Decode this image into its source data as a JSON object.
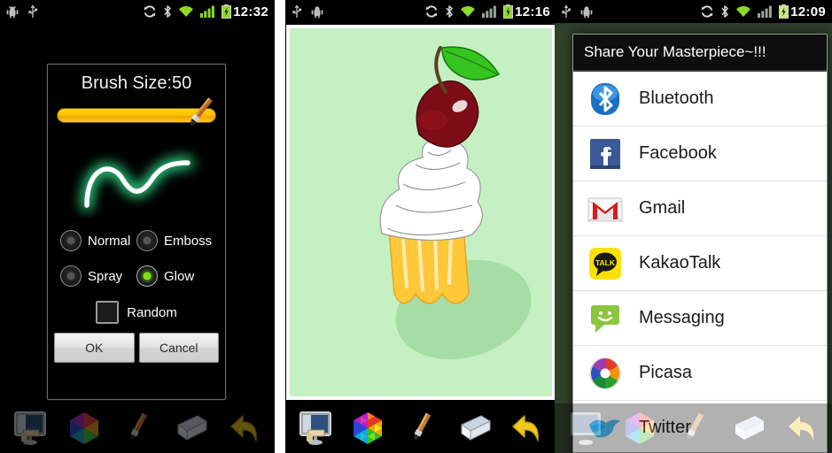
{
  "panels": [
    {
      "id": "brush-settings",
      "statusbar": {
        "time": "12:32",
        "left_icons": [
          "android-debug-icon",
          "usb-icon"
        ],
        "right_icons": [
          "sync-icon",
          "bluetooth-icon",
          "wifi-icon",
          "signal-icon",
          "battery-icon"
        ]
      },
      "dialog": {
        "title": "Brush Size:50",
        "brush_size": 50,
        "slider": {
          "value": 100,
          "min": 0,
          "max": 100,
          "thumb": "paintbrush-thumb-icon"
        },
        "preview": {
          "stroke_color": "#ffffff",
          "glow_color": "#2fe08a",
          "shape": "squiggle"
        },
        "modes": [
          {
            "label": "Normal",
            "selected": false
          },
          {
            "label": "Emboss",
            "selected": false
          },
          {
            "label": "Spray",
            "selected": false
          },
          {
            "label": "Glow",
            "selected": true
          }
        ],
        "checkbox": {
          "label": "Random",
          "checked": false
        },
        "buttons": {
          "ok": "OK",
          "cancel": "Cancel"
        }
      },
      "toolbar": [
        {
          "name": "new-canvas-icon"
        },
        {
          "name": "color-palette-icon"
        },
        {
          "name": "brush-icon"
        },
        {
          "name": "eraser-icon"
        },
        {
          "name": "undo-icon"
        }
      ]
    },
    {
      "id": "canvas",
      "statusbar": {
        "time": "12:16",
        "left_icons": [
          "usb-icon",
          "android-debug-icon"
        ],
        "right_icons": [
          "sync-icon",
          "bluetooth-icon",
          "wifi-icon",
          "signal-icon",
          "battery-icon"
        ]
      },
      "artwork": {
        "subject": "cupcake-with-cherry",
        "background_color": "#c4f0c4",
        "cherry_color": "#7c0d16",
        "leaf_color": "#35c420",
        "cream_color": "#ffffff",
        "cup_color": "#ffc838"
      },
      "toolbar": [
        {
          "name": "new-canvas-icon"
        },
        {
          "name": "color-palette-icon"
        },
        {
          "name": "brush-icon"
        },
        {
          "name": "eraser-icon"
        },
        {
          "name": "undo-icon"
        }
      ]
    },
    {
      "id": "share",
      "statusbar": {
        "time": "12:09",
        "left_icons": [
          "usb-icon",
          "android-debug-icon"
        ],
        "right_icons": [
          "sync-icon",
          "bluetooth-icon",
          "wifi-icon",
          "signal-icon",
          "battery-icon"
        ]
      },
      "dialog": {
        "title": "Share Your Masterpiece~!!!",
        "items": [
          {
            "label": "Bluetooth",
            "icon": "bluetooth-app-icon"
          },
          {
            "label": "Facebook",
            "icon": "facebook-app-icon"
          },
          {
            "label": "Gmail",
            "icon": "gmail-app-icon"
          },
          {
            "label": "KakaoTalk",
            "icon": "kakaotalk-app-icon"
          },
          {
            "label": "Messaging",
            "icon": "messaging-app-icon"
          },
          {
            "label": "Picasa",
            "icon": "picasa-app-icon"
          },
          {
            "label": "Twitter",
            "icon": "twitter-app-icon"
          }
        ]
      },
      "toolbar": [
        {
          "name": "new-canvas-icon"
        },
        {
          "name": "color-palette-icon"
        },
        {
          "name": "brush-icon"
        },
        {
          "name": "eraser-icon"
        },
        {
          "name": "undo-icon"
        }
      ]
    }
  ],
  "colors": {
    "slider_fill": "#ffc400",
    "glow_green": "#2fe08a",
    "selected_radio": "#7ee011",
    "canvas_bg": "#c4f0c4",
    "dialog_bg": "#000000",
    "share_bg": "#ffffff"
  }
}
